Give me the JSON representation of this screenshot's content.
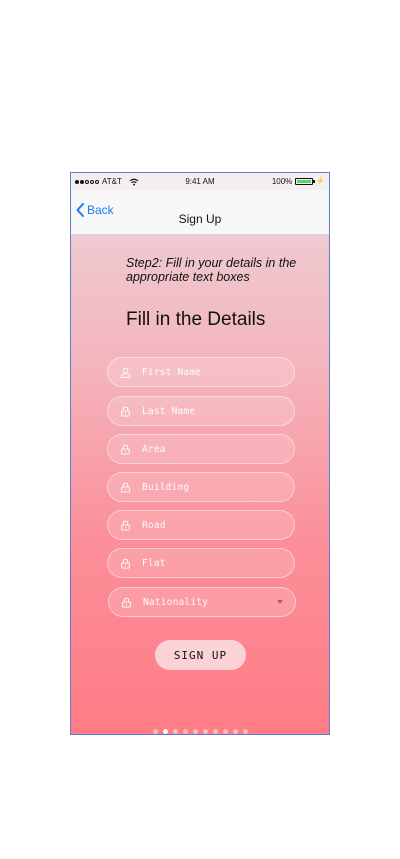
{
  "status_bar": {
    "carrier": "AT&T",
    "time": "9:41 AM",
    "battery": "100%"
  },
  "nav": {
    "back_label": "Back",
    "title": "Sign Up"
  },
  "content": {
    "step_text": "Step2: Fill in your details in the appropriate text boxes",
    "heading": "Fill in the Details"
  },
  "form": {
    "fields": [
      {
        "placeholder": "First Name",
        "icon": "user-icon"
      },
      {
        "placeholder": "Last Name",
        "icon": "lock-icon"
      },
      {
        "placeholder": "Area",
        "icon": "lock-icon"
      },
      {
        "placeholder": "Building",
        "icon": "lock-icon"
      },
      {
        "placeholder": "Road",
        "icon": "lock-icon"
      },
      {
        "placeholder": "Flat",
        "icon": "lock-icon"
      }
    ],
    "nationality_placeholder": "Nationality",
    "submit_label": "SIGN UP"
  },
  "pager": {
    "total": 10,
    "active": 2
  },
  "colors": {
    "accent": "#1a7cf5",
    "gradient_top": "#ecd4d9",
    "gradient_bottom": "#ff7c86",
    "button_bg": "#fbd3d6"
  }
}
